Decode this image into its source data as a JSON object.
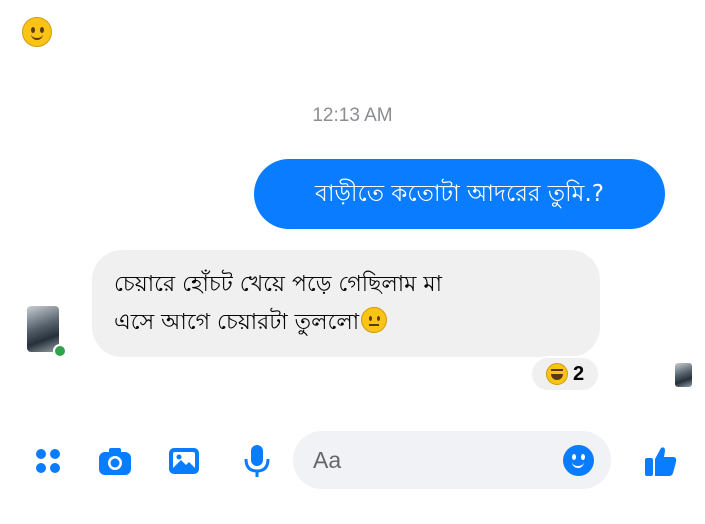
{
  "header": {
    "emoji_icon": "slightly-smiling-face-icon"
  },
  "conversation": {
    "timestamp": "12:13 AM",
    "outgoing_message": "বাড়ীতে কতোটা আদরের তুমি.?",
    "incoming_message_line1": "চেয়ারে হোঁচট খেয়ে পড়ে গেছিলাম মা",
    "incoming_message_line2": "এসে আগে চেয়ারটা তুললো",
    "incoming_message_emoji": "neutral-face-icon",
    "reaction": {
      "emoji": "grinning-squinting-face-icon",
      "count": "2"
    }
  },
  "composer": {
    "icons": [
      "menu-dots-icon",
      "camera-icon",
      "image-icon",
      "microphone-icon",
      "emoji-icon",
      "like-icon"
    ],
    "placeholder": "Aa"
  },
  "colors": {
    "accent": "#0a7cff",
    "incoming_bubble": "#f0f0f0",
    "online": "#31a24c"
  }
}
